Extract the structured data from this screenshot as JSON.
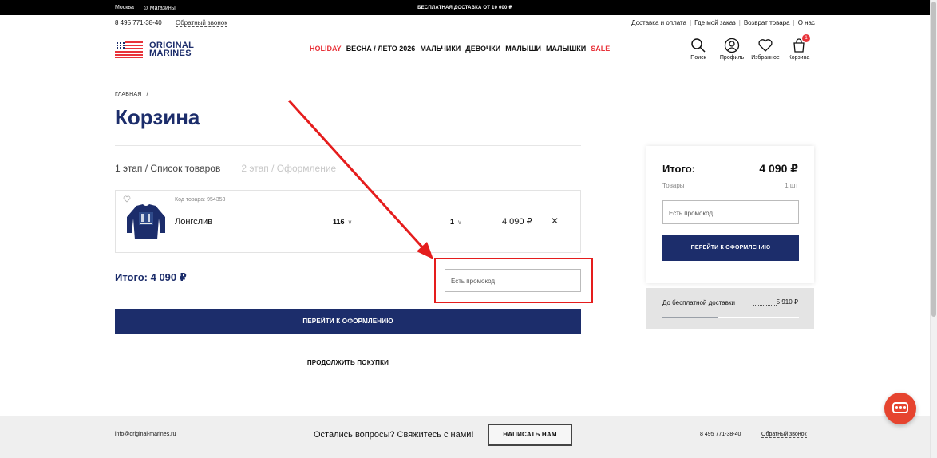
{
  "topbar": {
    "city": "Москва",
    "stores": "Магазины",
    "promo": "БЕСПЛАТНАЯ ДОСТАВКА ОТ 10 000 ₽"
  },
  "subbar": {
    "phone": "8 495 771-38-40",
    "callback": "Обратный звонок",
    "links": [
      "Доставка и оплата",
      "Где мой заказ",
      "Возврат товара",
      "О нас"
    ]
  },
  "logo": {
    "line1": "ORIGINAL",
    "line2": "MARINES"
  },
  "nav": {
    "holiday": "HOLIDAY",
    "spring": "ВЕСНА / ЛЕТО 2026",
    "boys": "МАЛЬЧИКИ",
    "girls": "ДЕВОЧКИ",
    "babies": "МАЛЫШИ",
    "kids": "МАЛЫШКИ",
    "sale": "SALE"
  },
  "header_icons": {
    "search": "Поиск",
    "profile": "Профиль",
    "favorites": "Избранное",
    "cart": "Корзина",
    "cart_count": "1"
  },
  "breadcrumb": {
    "home": "ГЛАВНАЯ",
    "sep": "/"
  },
  "page_title": "Корзина",
  "steps": {
    "step1": "1 этап / Список товаров",
    "step2": "2 этап / Оформление"
  },
  "cart_item": {
    "code": "Код товара: 954353",
    "name": "Лонгслив",
    "size": "116",
    "qty": "1",
    "price": "4 090 ₽",
    "remove": "✕"
  },
  "total_left": "Итого: 4 090 ₽",
  "promo_placeholder": "Есть промокод",
  "checkout_label": "ПЕРЕЙТИ К ОФОРМЛЕНИЮ",
  "continue_label": "ПРОДОЛЖИТЬ ПОКУПКИ",
  "summary": {
    "label": "Итого:",
    "value": "4 090 ₽",
    "goods_label": "Товары",
    "goods_qty": "1 шт",
    "promo_placeholder": "Есть промокод",
    "checkout_label": "ПЕРЕЙТИ К ОФОРМЛЕНИЮ"
  },
  "delivery": {
    "label": "До бесплатной доставки",
    "remaining": "5 910 ₽",
    "progress": 0.409
  },
  "footer": {
    "email": "info@original-marines.ru",
    "question": "Остались вопросы? Свяжитесь с нами!",
    "write_button": "НАПИСАТЬ НАМ",
    "phone": "8 495 771-38-40",
    "callback": "Обратный звонок"
  },
  "colors": {
    "brand_navy": "#1c2d6b",
    "accent_red": "#e8333a",
    "annotation_red": "#e51d1d",
    "chat_orange": "#e6442f"
  }
}
